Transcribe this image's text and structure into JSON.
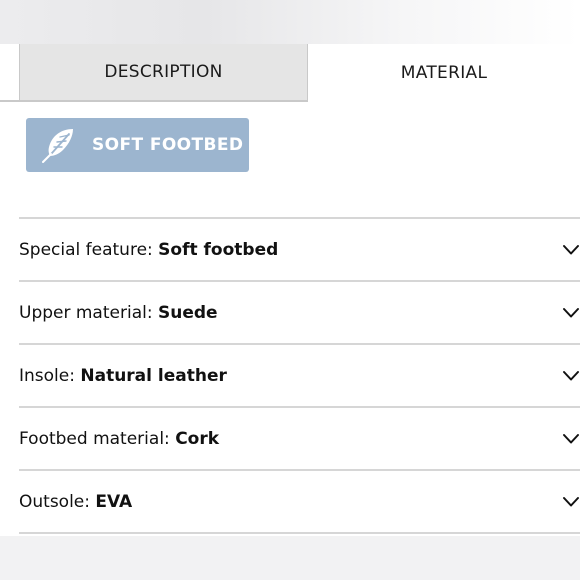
{
  "tabs": {
    "description_label": "DESCRIPTION",
    "material_label": "MATERIAL",
    "active": "MATERIAL"
  },
  "badge": {
    "icon": "feather-icon",
    "label": "SOFT FOOTBED",
    "color": "#9cb5cf"
  },
  "specs": [
    {
      "key": "Special feature:",
      "value": "Soft footbed"
    },
    {
      "key": "Upper material:",
      "value": "Suede"
    },
    {
      "key": "Insole:",
      "value": "Natural leather"
    },
    {
      "key": "Footbed material:",
      "value": "Cork"
    },
    {
      "key": "Outsole:",
      "value": "EVA"
    }
  ]
}
